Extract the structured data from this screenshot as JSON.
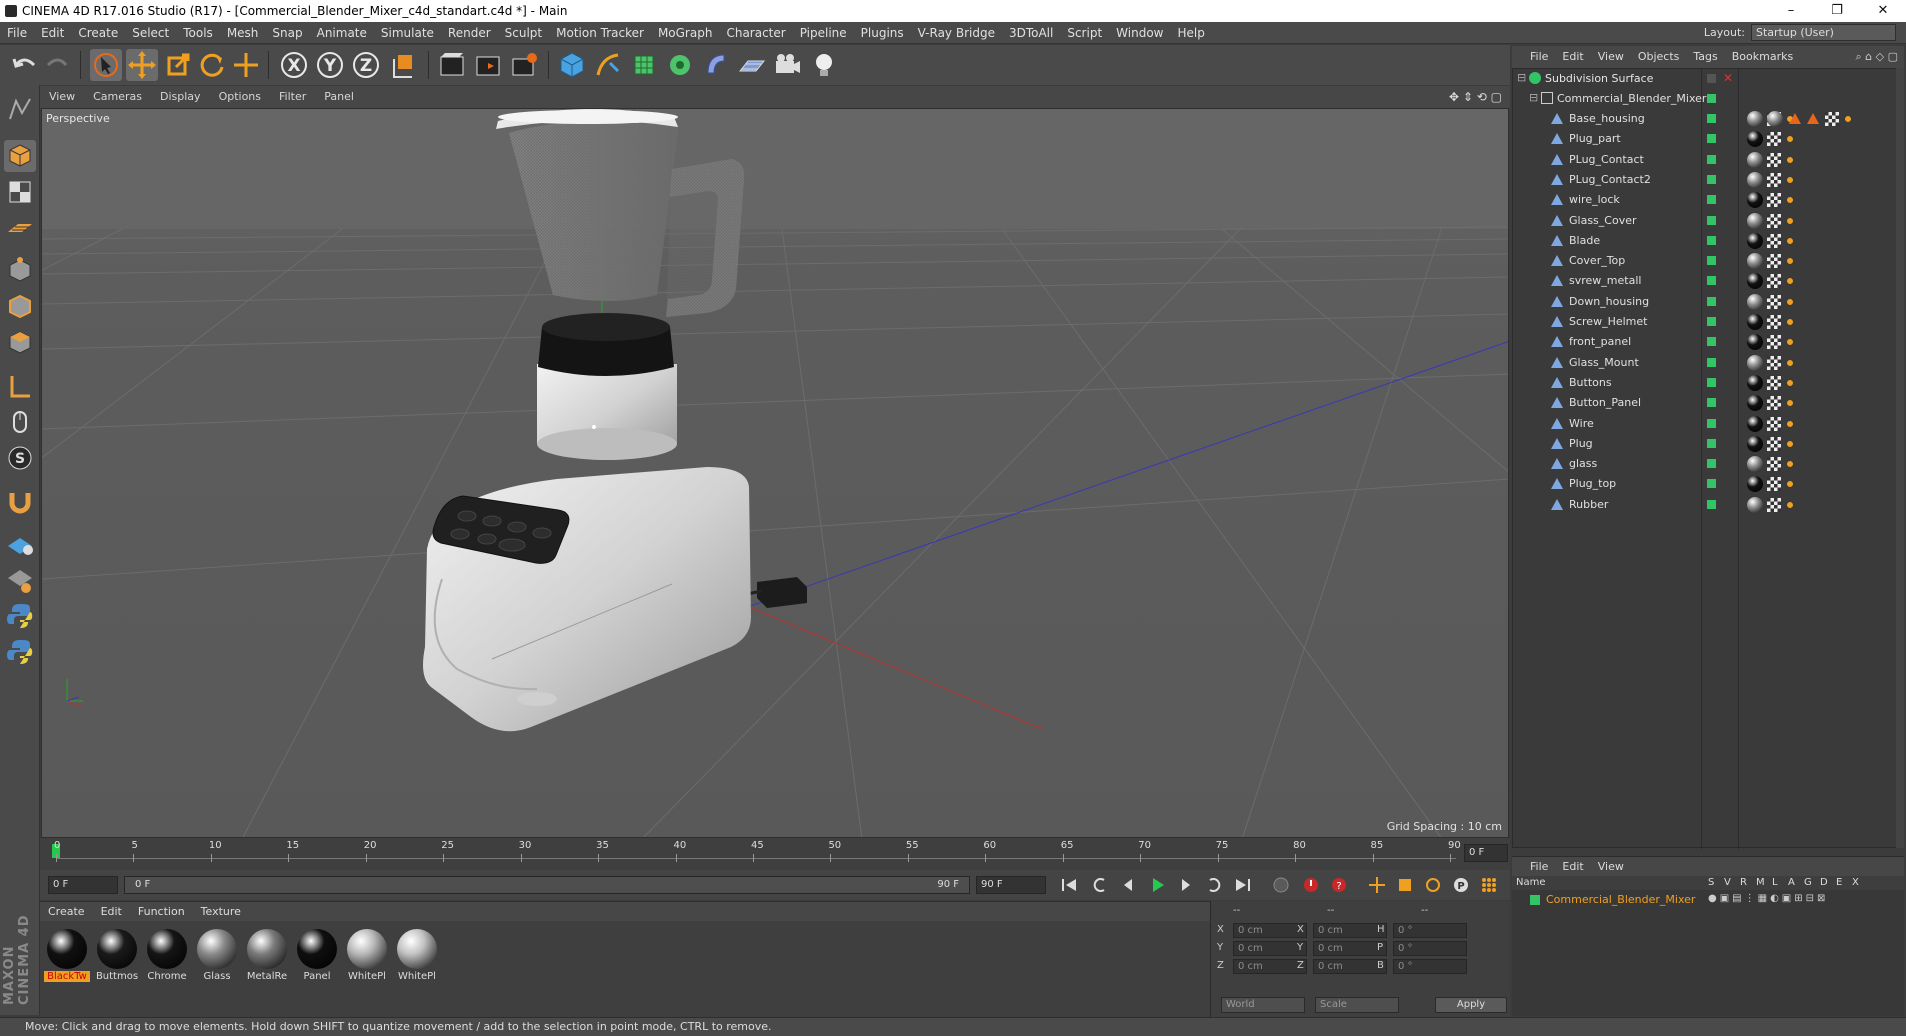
{
  "window": {
    "title": "CINEMA 4D R17.016 Studio (R17) - [Commercial_Blender_Mixer_c4d_standart.c4d *] - Main",
    "minimize": "–",
    "maximize": "❐",
    "close": "✕"
  },
  "menubar": [
    "File",
    "Edit",
    "Create",
    "Select",
    "Tools",
    "Mesh",
    "Snap",
    "Animate",
    "Simulate",
    "Render",
    "Sculpt",
    "Motion Tracker",
    "MoGraph",
    "Character",
    "Pipeline",
    "Plugins",
    "V-Ray Bridge",
    "3DToAll",
    "Script",
    "Window",
    "Help"
  ],
  "layout": {
    "label": "Layout:",
    "value": "Startup (User)"
  },
  "viewport": {
    "menu": [
      "View",
      "Cameras",
      "Display",
      "Options",
      "Filter",
      "Panel"
    ],
    "label": "Perspective",
    "grid_spacing": "Grid Spacing : 10 cm"
  },
  "timeline": {
    "ticks": [
      "0",
      "5",
      "10",
      "15",
      "20",
      "25",
      "30",
      "35",
      "40",
      "45",
      "50",
      "55",
      "60",
      "65",
      "70",
      "75",
      "80",
      "85",
      "90"
    ],
    "current_frame": "0 F",
    "start_field": "0 F",
    "range_start": "0 F",
    "range_end": "90 F",
    "end_field": "90 F"
  },
  "material_manager": {
    "menu": [
      "Create",
      "Edit",
      "Function",
      "Texture"
    ],
    "materials": [
      {
        "name": "BlackTw",
        "color": "#111111",
        "selected": true
      },
      {
        "name": "Buttmos",
        "color": "#1a1a1a",
        "selected": false
      },
      {
        "name": "Chrome",
        "color": "#151515",
        "selected": false
      },
      {
        "name": "Glass",
        "color": "#8a8a8a",
        "selected": false
      },
      {
        "name": "MetalRe",
        "color": "#7b7b7b",
        "selected": false
      },
      {
        "name": "Panel",
        "color": "#0f0f0f",
        "selected": false
      },
      {
        "name": "WhitePl",
        "color": "#b8b8b8",
        "selected": false
      },
      {
        "name": "WhitePl",
        "color": "#c2c2c2",
        "selected": false
      }
    ]
  },
  "coordinates": {
    "headers": [
      "--",
      "--",
      "--"
    ],
    "rows": [
      {
        "a": "X",
        "av": "0 cm",
        "b": "X",
        "bv": "0 cm",
        "c": "H",
        "cv": "0 °"
      },
      {
        "a": "Y",
        "av": "0 cm",
        "b": "Y",
        "bv": "0 cm",
        "c": "P",
        "cv": "0 °"
      },
      {
        "a": "Z",
        "av": "0 cm",
        "b": "Z",
        "bv": "0 cm",
        "c": "B",
        "cv": "0 °"
      }
    ],
    "space": "World",
    "mode": "Scale",
    "apply": "Apply"
  },
  "object_manager": {
    "menu": [
      "File",
      "Edit",
      "View",
      "Objects",
      "Tags",
      "Bookmarks"
    ],
    "root": "Subdivision Surface",
    "group": "Commercial_Blender_Mixer",
    "objects": [
      "Base_housing",
      "Plug_part",
      "PLug_Contact",
      "PLug_Contact2",
      "wire_lock",
      "Glass_Cover",
      "Blade",
      "Cover_Top",
      "svrew_metall",
      "Down_housing",
      "Screw_Helmet",
      "front_panel",
      "Glass_Mount",
      "Buttons",
      "Button_Panel",
      "Wire",
      "Plug",
      "glass",
      "Plug_top",
      "Rubber"
    ]
  },
  "layer_manager": {
    "menu": [
      "File",
      "Edit",
      "View"
    ],
    "col_name": "Name",
    "cols": [
      "S",
      "V",
      "R",
      "M",
      "L",
      "A",
      "G",
      "D",
      "E",
      "X"
    ],
    "layer": "Commercial_Blender_Mixer"
  },
  "status": "Move: Click and drag to move elements. Hold down SHIFT to quantize movement / add to the selection in point mode, CTRL to remove."
}
